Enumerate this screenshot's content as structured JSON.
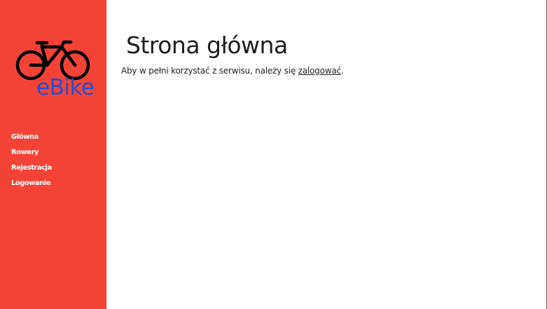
{
  "brand": {
    "logo_text": "eBike",
    "logo_icon": "bicycle-icon",
    "icon_color": "#000000",
    "text_color": "#1f4fd6"
  },
  "colors": {
    "sidebar_bg": "#f44336",
    "main_bg": "#ffffff",
    "nav_text": "#ffffff",
    "title_text": "#1d1d1d"
  },
  "sidebar": {
    "items": [
      {
        "label": "Główna"
      },
      {
        "label": "Rowery"
      },
      {
        "label": "Rejestracja"
      },
      {
        "label": "Logowanie"
      }
    ]
  },
  "main": {
    "title": "Strona główna",
    "intro_before": "Aby w pełni korzystać z serwisu, należy się ",
    "intro_link": "zalogować",
    "intro_after": "."
  }
}
